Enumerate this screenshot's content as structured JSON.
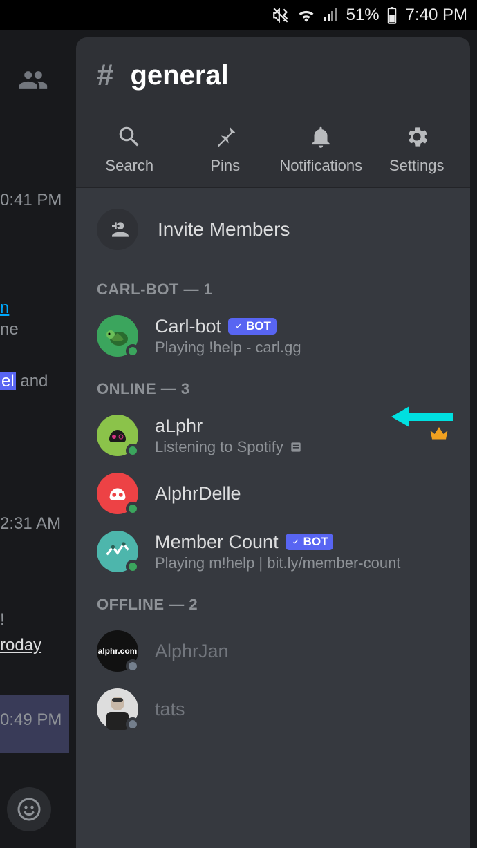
{
  "statusbar": {
    "battery_pct": "51%",
    "time": "7:40 PM"
  },
  "background_chat": {
    "ts1": "0:41 PM",
    "frag_link": "n",
    "frag_line2": "ne",
    "frag_line3": "el and",
    "ts2": "2:31 AM",
    "frag_excl": "!",
    "frag_today": "roday",
    "ts4": "0:49 PM"
  },
  "channel": {
    "name": "general"
  },
  "actions": {
    "search": "Search",
    "pins": "Pins",
    "notifications": "Notifications",
    "settings": "Settings"
  },
  "invite_label": "Invite Members",
  "sections": [
    {
      "title": "CARL-BOT — 1",
      "members": [
        {
          "name": "Carl-bot",
          "bot": true,
          "verified_bot": true,
          "status_text": "Playing !help - carl.gg",
          "presence": "online",
          "avatar_class": "av-turtle",
          "name_faded": false,
          "crown": false
        }
      ]
    },
    {
      "title": "ONLINE — 3",
      "members": [
        {
          "name": "aLphr",
          "bot": false,
          "status_text": "Listening to Spotify",
          "rich_presence": true,
          "presence": "online",
          "avatar_class": "av-alphr",
          "name_faded": false,
          "crown": true,
          "annotated": true
        },
        {
          "name": "AlphrDelle",
          "bot": false,
          "status_text": "",
          "presence": "online",
          "avatar_class": "av-delle",
          "name_faded": false,
          "crown": false
        },
        {
          "name": "Member Count",
          "bot": true,
          "verified_bot": true,
          "status_text": "Playing m!help | bit.ly/member-count",
          "presence": "online",
          "avatar_class": "av-mc",
          "name_faded": false,
          "crown": false
        }
      ]
    },
    {
      "title": "OFFLINE — 2",
      "members": [
        {
          "name": "AlphrJan",
          "bot": false,
          "status_text": "",
          "presence": "offline",
          "avatar_class": "av-jan",
          "avatar_text": "alphr.com",
          "name_faded": true,
          "crown": false
        },
        {
          "name": "tats",
          "bot": false,
          "status_text": "",
          "presence": "offline",
          "avatar_class": "av-tats",
          "name_faded": true,
          "crown": false
        }
      ]
    }
  ],
  "bot_badge_text": "BOT"
}
